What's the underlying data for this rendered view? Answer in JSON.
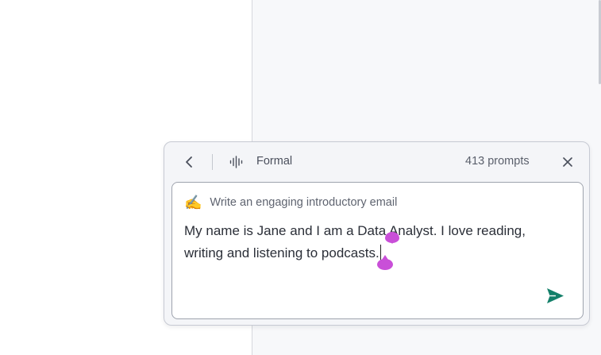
{
  "panel": {
    "tone": "Formal",
    "prompt_count": "413 prompts",
    "prompt_emoji": "✍️",
    "prompt_title": "Write an engaging introductory email",
    "user_text": "My name is Jane and I am a Data Analyst. I love reading, writing and listening to podcasts."
  },
  "colors": {
    "accent_send": "#14806a",
    "selection_handle": "#c94fd8",
    "panel_bg": "#f4f5f8"
  },
  "icons": {
    "back": "chevron-left-icon",
    "tone": "sound-wave-icon",
    "close": "close-icon",
    "prompt": "writing-hand-icon",
    "send": "send-icon"
  }
}
